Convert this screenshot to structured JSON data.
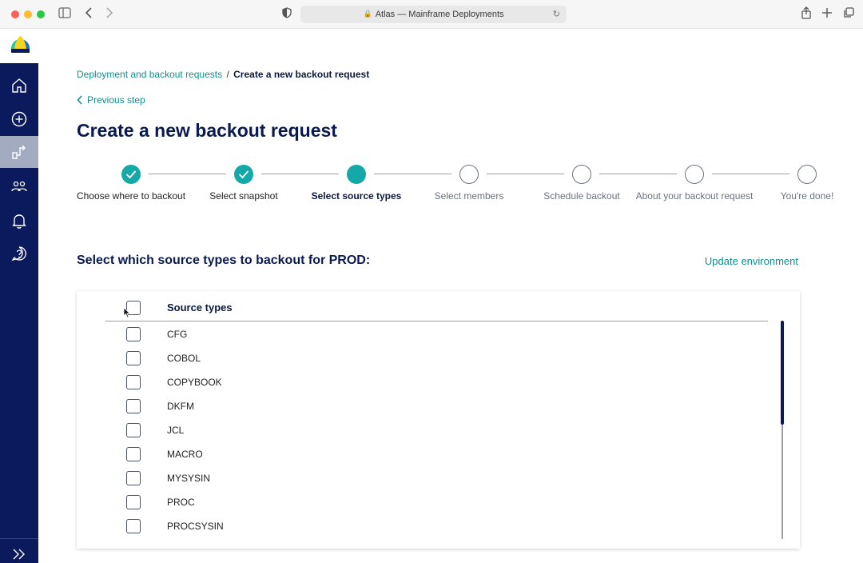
{
  "browser": {
    "address": "Atlas — Mainframe Deployments",
    "icons": [
      "sidebar-toggle-icon",
      "back-icon",
      "forward-icon",
      "shield-icon",
      "lock-icon",
      "reload-icon",
      "share-icon",
      "new-tab-icon",
      "tabs-icon"
    ]
  },
  "sidebar": {
    "items": [
      {
        "name": "home",
        "icon": "home-icon",
        "active": false
      },
      {
        "name": "create",
        "icon": "plus-circle-icon",
        "active": false
      },
      {
        "name": "deployments",
        "icon": "deploy-icon",
        "active": true
      },
      {
        "name": "teams",
        "icon": "users-icon",
        "active": false
      },
      {
        "name": "notifications",
        "icon": "bell-icon",
        "active": false
      },
      {
        "name": "help",
        "icon": "help-icon",
        "active": false
      }
    ],
    "expand_icon": "double-chevron-right-icon"
  },
  "breadcrumb": {
    "parent": "Deployment and backout requests",
    "separator": "/",
    "current": "Create a new backout request"
  },
  "previous_step": "Previous step",
  "page_title": "Create a new backout request",
  "stepper": {
    "steps": [
      {
        "label": "Choose where to backout",
        "state": "done"
      },
      {
        "label": "Select snapshot",
        "state": "done"
      },
      {
        "label": "Select source types",
        "state": "current"
      },
      {
        "label": "Select members",
        "state": "todo"
      },
      {
        "label": "Schedule backout",
        "state": "todo"
      },
      {
        "label": "About your backout request",
        "state": "todo"
      },
      {
        "label": "You're done!",
        "state": "todo"
      }
    ]
  },
  "section": {
    "title": "Select which source types to backout for PROD:",
    "update_link": "Update environment"
  },
  "table": {
    "header": "Source types",
    "rows": [
      "CFG",
      "COBOL",
      "COPYBOOK",
      "DKFM",
      "JCL",
      "MACRO",
      "MYSYSIN",
      "PROC",
      "PROCSYSIN"
    ]
  },
  "colors": {
    "navy": "#0a1a5c",
    "teal": "#15a8a8",
    "link": "#0e8f8f"
  }
}
